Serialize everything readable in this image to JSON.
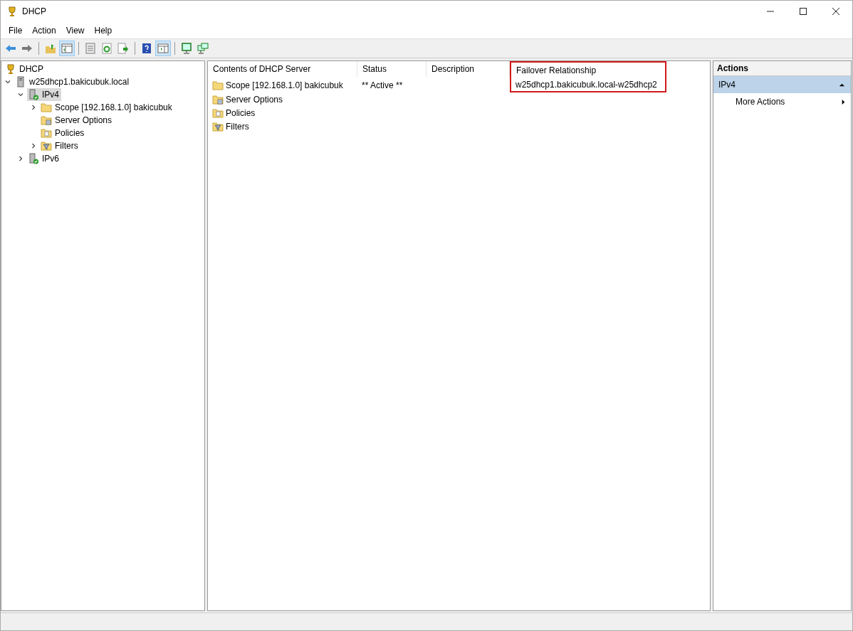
{
  "window": {
    "title": "DHCP"
  },
  "menu": [
    "File",
    "Action",
    "View",
    "Help"
  ],
  "toolbar": [
    {
      "kind": "back",
      "pressed": false
    },
    {
      "kind": "forward",
      "pressed": false
    },
    {
      "kind": "separator"
    },
    {
      "kind": "up",
      "pressed": false
    },
    {
      "kind": "tree",
      "pressed": true
    },
    {
      "kind": "separator"
    },
    {
      "kind": "properties",
      "pressed": false
    },
    {
      "kind": "refresh",
      "pressed": false
    },
    {
      "kind": "export",
      "pressed": false
    },
    {
      "kind": "separator"
    },
    {
      "kind": "help",
      "pressed": false
    },
    {
      "kind": "actionpane",
      "pressed": true
    },
    {
      "kind": "separator"
    },
    {
      "kind": "monitor",
      "pressed": false
    },
    {
      "kind": "monitors",
      "pressed": false
    }
  ],
  "tree": [
    {
      "label": "DHCP",
      "kind": "dhcp",
      "selected": false,
      "children": [
        {
          "label": "w25dhcp1.bakicubuk.local",
          "kind": "server",
          "selected": false,
          "expanded": true,
          "children": [
            {
              "label": "IPv4",
              "kind": "ip",
              "selected": true,
              "expanded": true,
              "children": [
                {
                  "label": "Scope [192.168.1.0] bakicubuk",
                  "kind": "folder",
                  "selected": false,
                  "expanded": false
                },
                {
                  "label": "Server Options",
                  "kind": "options",
                  "selected": false
                },
                {
                  "label": "Policies",
                  "kind": "policies",
                  "selected": false
                },
                {
                  "label": "Filters",
                  "kind": "filters",
                  "selected": false,
                  "expanded": false
                }
              ]
            },
            {
              "label": "IPv6",
              "kind": "ip",
              "selected": false,
              "expanded": false
            }
          ]
        }
      ]
    }
  ],
  "table": {
    "columns": [
      {
        "label": "Contents of DHCP Server",
        "highlighted": false
      },
      {
        "label": "Status",
        "highlighted": false
      },
      {
        "label": "Description",
        "highlighted": false
      },
      {
        "label": "Failover Relationship",
        "highlighted": true
      }
    ],
    "rows": [
      {
        "kind": "folder",
        "cells": [
          "Scope [192.168.1.0] bakicubuk",
          "** Active **",
          "",
          "w25dhcp1.bakicubuk.local-w25dhcp2"
        ]
      },
      {
        "kind": "options",
        "cells": [
          "Server Options",
          "",
          "",
          ""
        ]
      },
      {
        "kind": "policies",
        "cells": [
          "Policies",
          "",
          "",
          ""
        ]
      },
      {
        "kind": "filters",
        "cells": [
          "Filters",
          "",
          "",
          ""
        ]
      }
    ]
  },
  "actions": {
    "title": "Actions",
    "section": {
      "label": "IPv4",
      "expanded": true
    },
    "items": [
      "More Actions"
    ]
  }
}
